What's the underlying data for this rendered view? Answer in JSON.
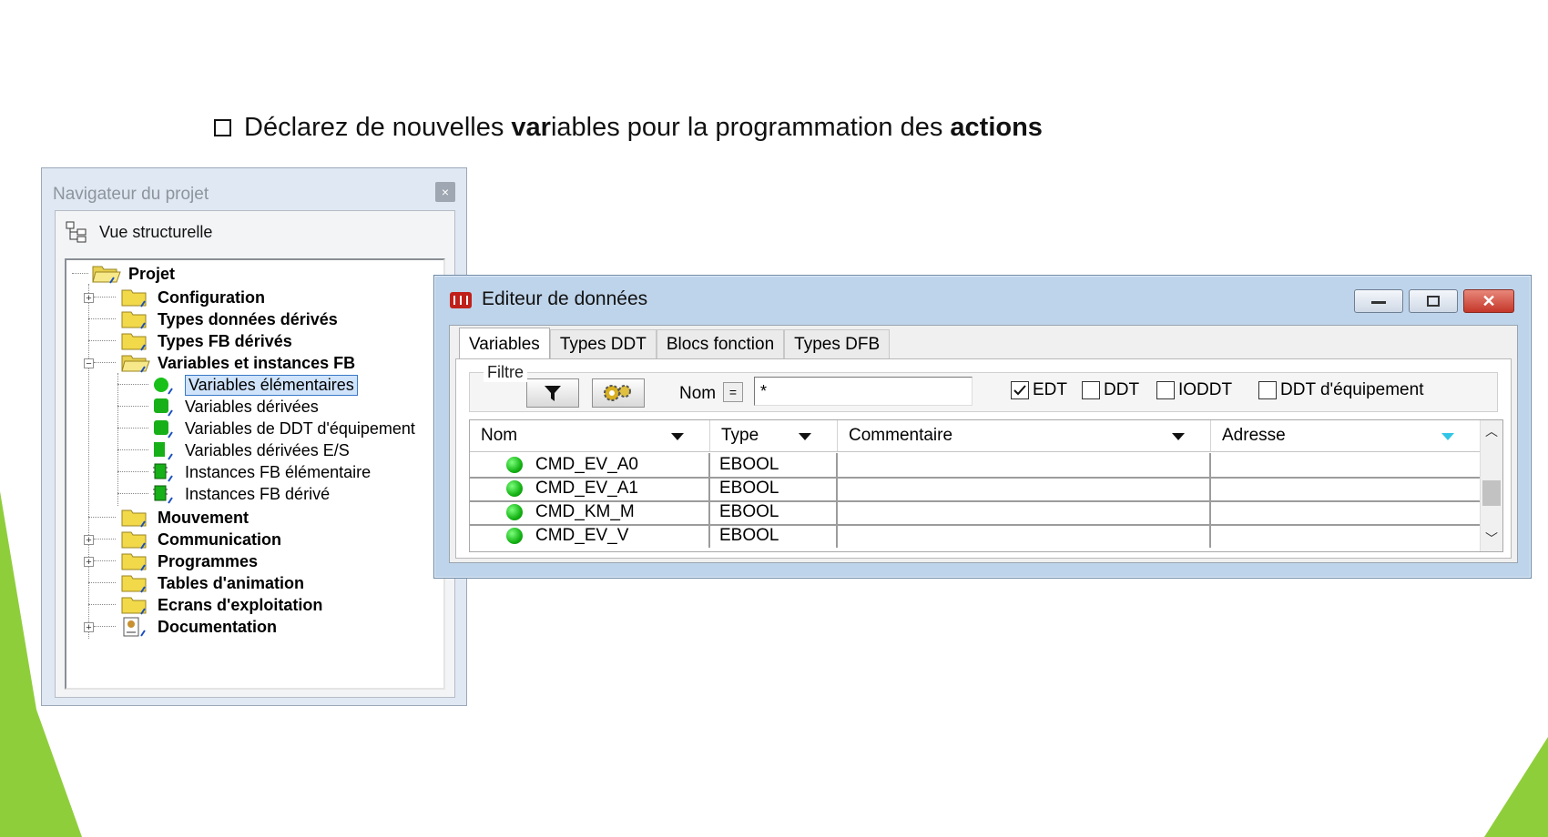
{
  "slide": {
    "title_pre": "Déclarez de nouvelles ",
    "title_b1": "var",
    "title_mid": "iables pour la programmation des ",
    "title_b2": "actions"
  },
  "navigator": {
    "title": "Navigateur du projet",
    "close": "×",
    "view_label": "Vue structurelle",
    "tree": [
      {
        "label": "Projet",
        "bold": true
      },
      {
        "label": "Configuration",
        "bold": true
      },
      {
        "label": "Types données dérivés",
        "bold": true
      },
      {
        "label": "Types FB dérivés",
        "bold": true
      },
      {
        "label": "Variables et instances FB",
        "bold": true
      },
      {
        "label": "Variables élémentaires",
        "bold": false,
        "selected": true
      },
      {
        "label": "Variables dérivées",
        "bold": false
      },
      {
        "label": "Variables de DDT d'équipement",
        "bold": false
      },
      {
        "label": "Variables dérivées E/S",
        "bold": false
      },
      {
        "label": "Instances FB élémentaire",
        "bold": false
      },
      {
        "label": "Instances FB dérivé",
        "bold": false
      },
      {
        "label": "Mouvement",
        "bold": true
      },
      {
        "label": "Communication",
        "bold": true
      },
      {
        "label": "Programmes",
        "bold": true
      },
      {
        "label": "Tables d'animation",
        "bold": true
      },
      {
        "label": "Ecrans d'exploitation",
        "bold": true
      },
      {
        "label": "Documentation",
        "bold": true
      }
    ]
  },
  "editor": {
    "title": "Editeur de données",
    "tabs": [
      "Variables",
      "Types DDT",
      "Blocs fonction",
      "Types DFB"
    ],
    "filter_label": "Filtre",
    "nom_label": "Nom",
    "eq_label": "=",
    "nom_value": "*",
    "checkboxes": [
      {
        "label": "EDT",
        "checked": true
      },
      {
        "label": "DDT",
        "checked": false
      },
      {
        "label": "IODDT",
        "checked": false
      },
      {
        "label": "DDT d'équipement",
        "checked": false
      }
    ],
    "columns": [
      "Nom",
      "Type",
      "Commentaire",
      "Adresse"
    ],
    "rows": [
      {
        "name": "CMD_EV_A0",
        "type": "EBOOL"
      },
      {
        "name": "CMD_EV_A1",
        "type": "EBOOL"
      },
      {
        "name": "CMD_KM_M",
        "type": "EBOOL"
      },
      {
        "name": "CMD_EV_V",
        "type": "EBOOL"
      }
    ]
  },
  "colors": {
    "accent_green": "#8fce3b",
    "window_frame": "#bed4ea"
  }
}
